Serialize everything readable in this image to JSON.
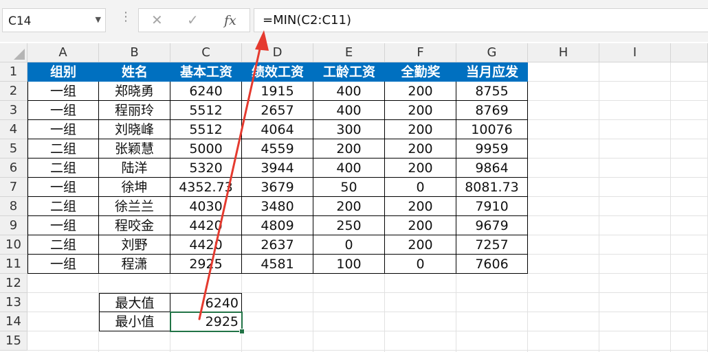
{
  "name_box": "C14",
  "formula": "=MIN(C2:C11)",
  "fx_label": "fx",
  "columns": [
    "A",
    "B",
    "C",
    "D",
    "E",
    "F",
    "G",
    "H",
    "I"
  ],
  "rows": [
    "1",
    "2",
    "3",
    "4",
    "5",
    "6",
    "7",
    "8",
    "9",
    "10",
    "11",
    "12",
    "13",
    "14",
    "15"
  ],
  "table": {
    "headers": [
      "组别",
      "姓名",
      "基本工资",
      "绩效工资",
      "工龄工资",
      "全勤奖",
      "当月应发"
    ],
    "rows": [
      [
        "一组",
        "郑晓勇",
        "6240",
        "1915",
        "400",
        "200",
        "8755"
      ],
      [
        "一组",
        "程丽玲",
        "5512",
        "2657",
        "400",
        "200",
        "8769"
      ],
      [
        "一组",
        "刘晓峰",
        "5512",
        "4064",
        "300",
        "200",
        "10076"
      ],
      [
        "二组",
        "张颖慧",
        "5000",
        "4559",
        "200",
        "200",
        "9959"
      ],
      [
        "二组",
        "陆洋",
        "5320",
        "3944",
        "400",
        "200",
        "9864"
      ],
      [
        "一组",
        "徐坤",
        "4352.73",
        "3679",
        "50",
        "0",
        "8081.73"
      ],
      [
        "二组",
        "徐兰兰",
        "4030",
        "3480",
        "200",
        "200",
        "7910"
      ],
      [
        "一组",
        "程咬金",
        "4420",
        "4809",
        "250",
        "200",
        "9679"
      ],
      [
        "二组",
        "刘野",
        "4420",
        "2637",
        "0",
        "200",
        "7257"
      ],
      [
        "一组",
        "程潇",
        "2925",
        "4581",
        "100",
        "0",
        "7606"
      ]
    ]
  },
  "summary": [
    {
      "label": "最大值",
      "value": "6240"
    },
    {
      "label": "最小值",
      "value": "2925"
    }
  ],
  "selected_cell": "C14",
  "annotation_color": "#e53a2f",
  "accent_color": "#217346",
  "header_fill": "#0070c0"
}
